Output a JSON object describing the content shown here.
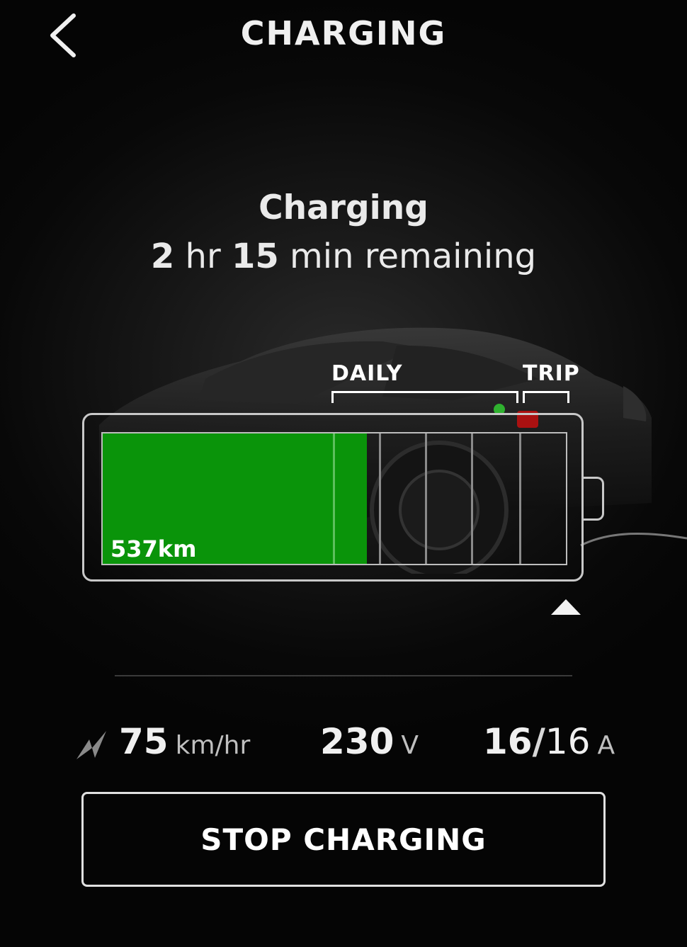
{
  "header": {
    "title": "CHARGING"
  },
  "status": {
    "title": "Charging",
    "remaining_hours": "2",
    "hours_unit": "hr",
    "remaining_minutes": "15",
    "minutes_unit": "min remaining"
  },
  "battery": {
    "range_label": "537km",
    "charge_level_fraction": 0.57,
    "daily_label": "DAILY",
    "trip_label": "TRIP",
    "fill_color": "#0a940a"
  },
  "stats": {
    "rate_value": "75",
    "rate_unit": "km/hr",
    "voltage_value": "230",
    "voltage_unit": "V",
    "current_actual": "16",
    "current_slash": "/",
    "current_max": "16",
    "current_unit": "A"
  },
  "actions": {
    "stop_label": "STOP CHARGING"
  },
  "icons": [
    "back-icon",
    "charging-bolt-icon",
    "charge-limit-arrow-icon"
  ]
}
